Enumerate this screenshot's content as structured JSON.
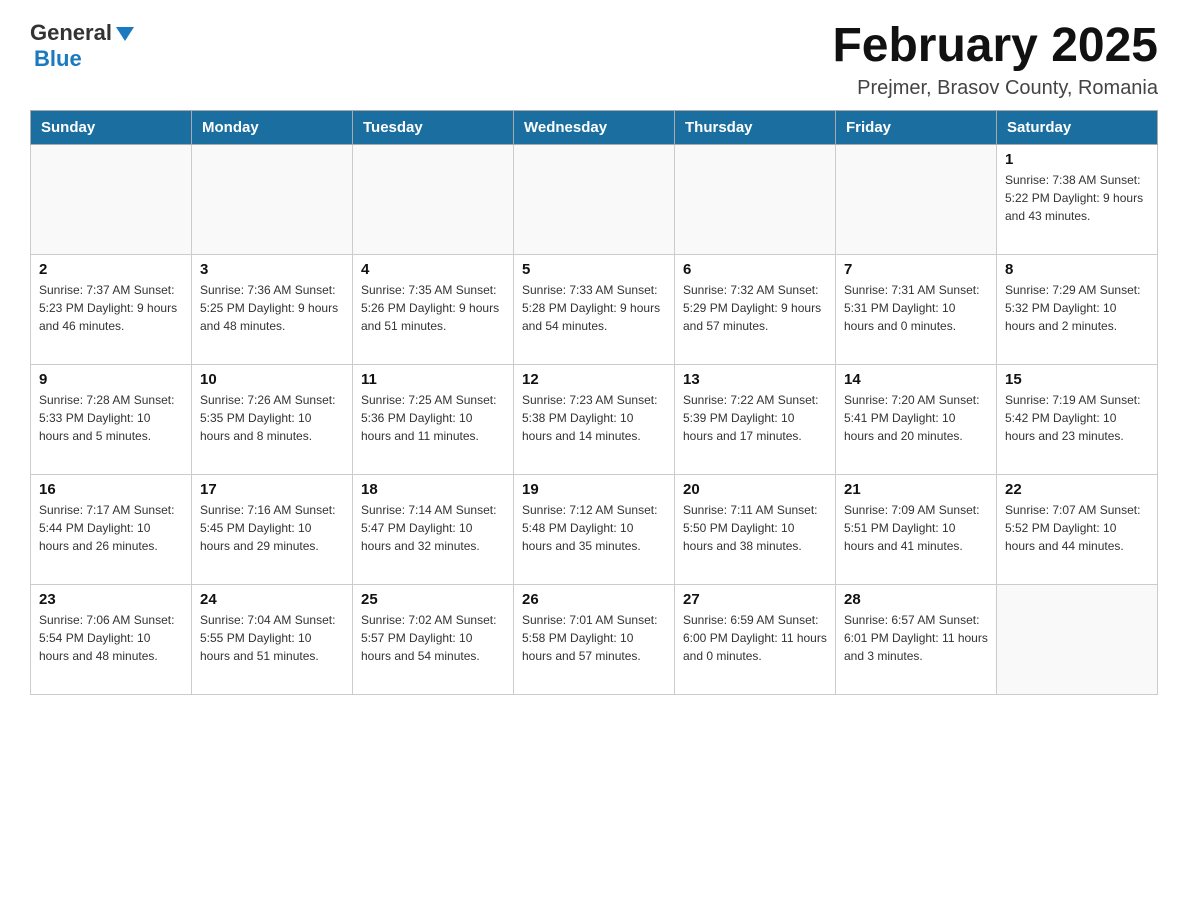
{
  "header": {
    "logo": {
      "general": "General",
      "blue": "Blue"
    },
    "title": "February 2025",
    "location": "Prejmer, Brasov County, Romania"
  },
  "weekdays": [
    "Sunday",
    "Monday",
    "Tuesday",
    "Wednesday",
    "Thursday",
    "Friday",
    "Saturday"
  ],
  "weeks": [
    [
      {
        "day": "",
        "info": ""
      },
      {
        "day": "",
        "info": ""
      },
      {
        "day": "",
        "info": ""
      },
      {
        "day": "",
        "info": ""
      },
      {
        "day": "",
        "info": ""
      },
      {
        "day": "",
        "info": ""
      },
      {
        "day": "1",
        "info": "Sunrise: 7:38 AM\nSunset: 5:22 PM\nDaylight: 9 hours and 43 minutes."
      }
    ],
    [
      {
        "day": "2",
        "info": "Sunrise: 7:37 AM\nSunset: 5:23 PM\nDaylight: 9 hours and 46 minutes."
      },
      {
        "day": "3",
        "info": "Sunrise: 7:36 AM\nSunset: 5:25 PM\nDaylight: 9 hours and 48 minutes."
      },
      {
        "day": "4",
        "info": "Sunrise: 7:35 AM\nSunset: 5:26 PM\nDaylight: 9 hours and 51 minutes."
      },
      {
        "day": "5",
        "info": "Sunrise: 7:33 AM\nSunset: 5:28 PM\nDaylight: 9 hours and 54 minutes."
      },
      {
        "day": "6",
        "info": "Sunrise: 7:32 AM\nSunset: 5:29 PM\nDaylight: 9 hours and 57 minutes."
      },
      {
        "day": "7",
        "info": "Sunrise: 7:31 AM\nSunset: 5:31 PM\nDaylight: 10 hours and 0 minutes."
      },
      {
        "day": "8",
        "info": "Sunrise: 7:29 AM\nSunset: 5:32 PM\nDaylight: 10 hours and 2 minutes."
      }
    ],
    [
      {
        "day": "9",
        "info": "Sunrise: 7:28 AM\nSunset: 5:33 PM\nDaylight: 10 hours and 5 minutes."
      },
      {
        "day": "10",
        "info": "Sunrise: 7:26 AM\nSunset: 5:35 PM\nDaylight: 10 hours and 8 minutes."
      },
      {
        "day": "11",
        "info": "Sunrise: 7:25 AM\nSunset: 5:36 PM\nDaylight: 10 hours and 11 minutes."
      },
      {
        "day": "12",
        "info": "Sunrise: 7:23 AM\nSunset: 5:38 PM\nDaylight: 10 hours and 14 minutes."
      },
      {
        "day": "13",
        "info": "Sunrise: 7:22 AM\nSunset: 5:39 PM\nDaylight: 10 hours and 17 minutes."
      },
      {
        "day": "14",
        "info": "Sunrise: 7:20 AM\nSunset: 5:41 PM\nDaylight: 10 hours and 20 minutes."
      },
      {
        "day": "15",
        "info": "Sunrise: 7:19 AM\nSunset: 5:42 PM\nDaylight: 10 hours and 23 minutes."
      }
    ],
    [
      {
        "day": "16",
        "info": "Sunrise: 7:17 AM\nSunset: 5:44 PM\nDaylight: 10 hours and 26 minutes."
      },
      {
        "day": "17",
        "info": "Sunrise: 7:16 AM\nSunset: 5:45 PM\nDaylight: 10 hours and 29 minutes."
      },
      {
        "day": "18",
        "info": "Sunrise: 7:14 AM\nSunset: 5:47 PM\nDaylight: 10 hours and 32 minutes."
      },
      {
        "day": "19",
        "info": "Sunrise: 7:12 AM\nSunset: 5:48 PM\nDaylight: 10 hours and 35 minutes."
      },
      {
        "day": "20",
        "info": "Sunrise: 7:11 AM\nSunset: 5:50 PM\nDaylight: 10 hours and 38 minutes."
      },
      {
        "day": "21",
        "info": "Sunrise: 7:09 AM\nSunset: 5:51 PM\nDaylight: 10 hours and 41 minutes."
      },
      {
        "day": "22",
        "info": "Sunrise: 7:07 AM\nSunset: 5:52 PM\nDaylight: 10 hours and 44 minutes."
      }
    ],
    [
      {
        "day": "23",
        "info": "Sunrise: 7:06 AM\nSunset: 5:54 PM\nDaylight: 10 hours and 48 minutes."
      },
      {
        "day": "24",
        "info": "Sunrise: 7:04 AM\nSunset: 5:55 PM\nDaylight: 10 hours and 51 minutes."
      },
      {
        "day": "25",
        "info": "Sunrise: 7:02 AM\nSunset: 5:57 PM\nDaylight: 10 hours and 54 minutes."
      },
      {
        "day": "26",
        "info": "Sunrise: 7:01 AM\nSunset: 5:58 PM\nDaylight: 10 hours and 57 minutes."
      },
      {
        "day": "27",
        "info": "Sunrise: 6:59 AM\nSunset: 6:00 PM\nDaylight: 11 hours and 0 minutes."
      },
      {
        "day": "28",
        "info": "Sunrise: 6:57 AM\nSunset: 6:01 PM\nDaylight: 11 hours and 3 minutes."
      },
      {
        "day": "",
        "info": ""
      }
    ]
  ]
}
